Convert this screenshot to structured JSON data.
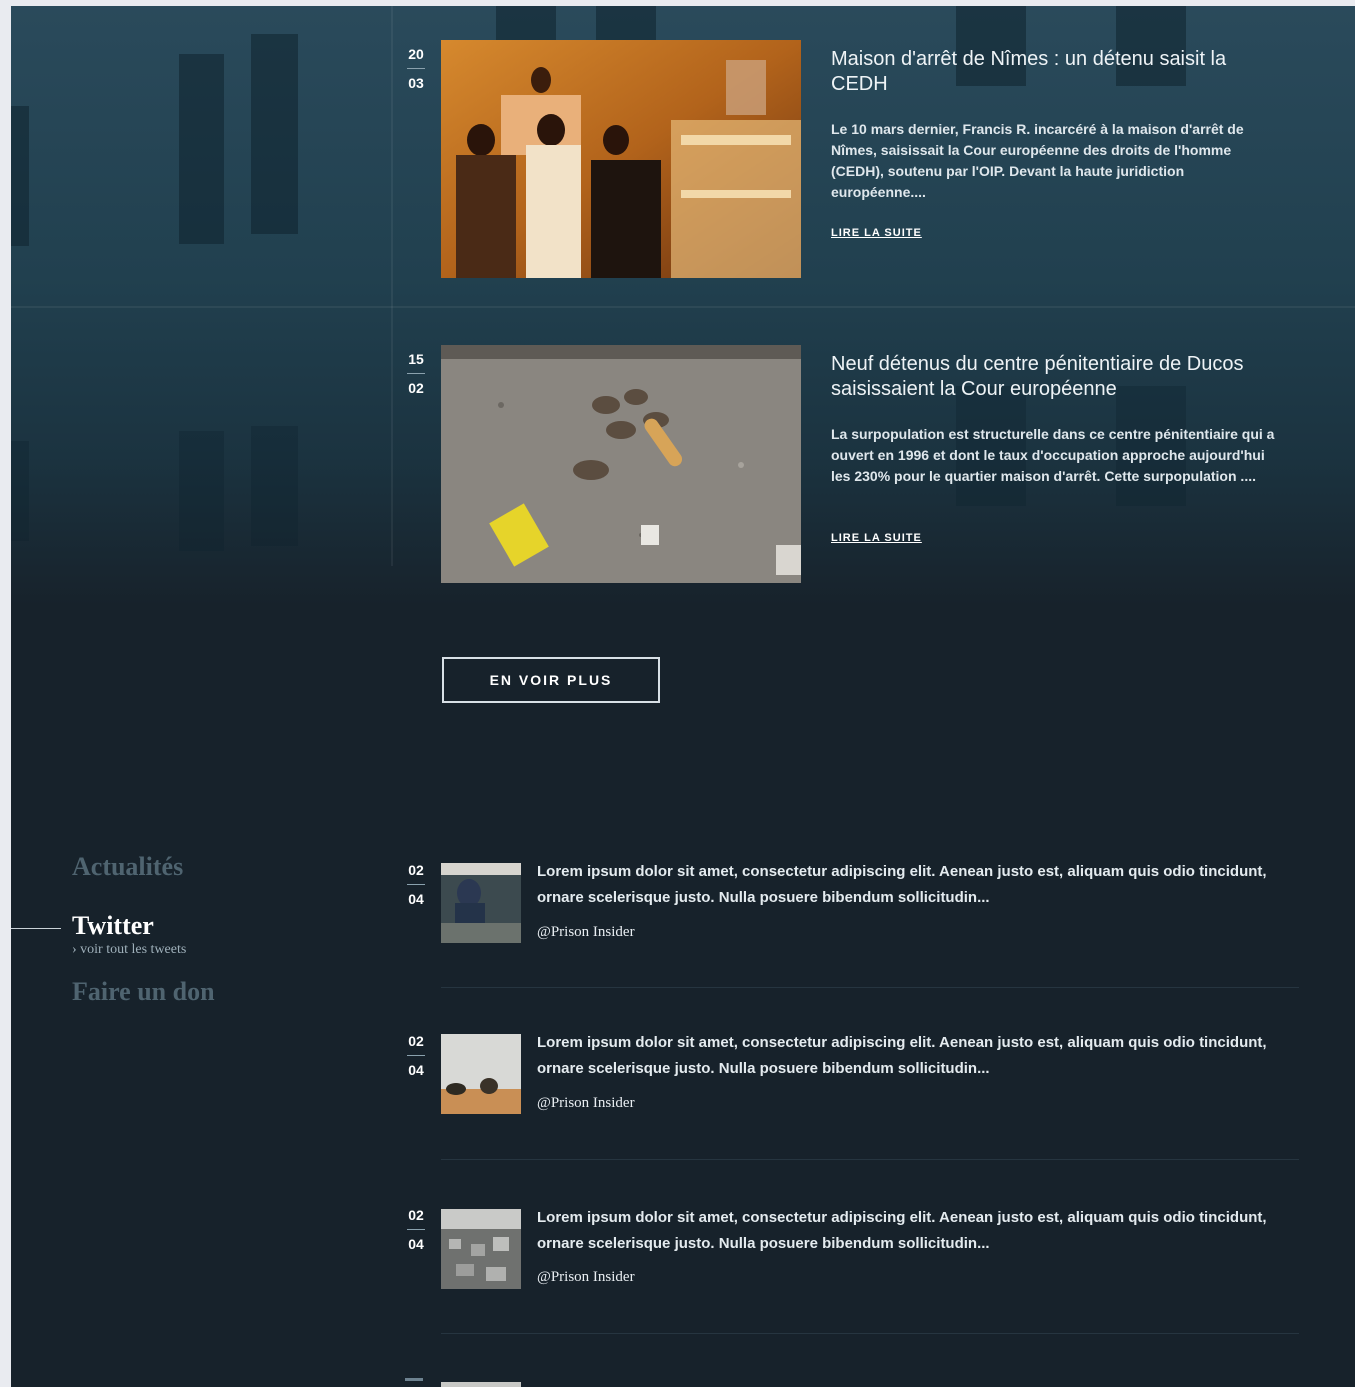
{
  "articles": [
    {
      "day": "20",
      "month": "03",
      "title": "Maison d'arrêt de Nîmes : un détenu saisit la CEDH",
      "excerpt": "Le 10 mars dernier, Francis R. incarcéré à la maison d'arrêt de Nîmes, saisissait la Cour européenne des droits de l'homme (CEDH), soutenu par l'OIP. Devant la haute juridiction européenne....",
      "link": "LIRE LA SUITE"
    },
    {
      "day": "15",
      "month": "02",
      "title": "Neuf détenus du centre pénitentiaire de Ducos saisissaient la Cour européenne",
      "excerpt": "La surpopulation est structurelle dans ce centre pénitentiaire qui a ouvert en 1996 et dont le taux d'occupation approche aujourd'hui les 230% pour le quartier maison d'arrêt. Cette surpopulation ....",
      "link": "LIRE LA SUITE"
    }
  ],
  "more_button": "EN VOIR PLUS",
  "sidenav": {
    "actualites": "Actualités",
    "twitter": "Twitter",
    "twitter_sub": "voir tout les tweets",
    "don": "Faire un don"
  },
  "tweets": [
    {
      "day": "02",
      "month": "04",
      "text": "Lorem ipsum dolor sit amet, consectetur adipiscing elit. Aenean justo est, aliquam quis odio tincidunt, ornare scelerisque justo. Nulla posuere bibendum sollicitudin...",
      "handle": "@Prison Insider"
    },
    {
      "day": "02",
      "month": "04",
      "text": "Lorem ipsum dolor sit amet, consectetur adipiscing elit. Aenean justo est, aliquam quis odio tincidunt, ornare scelerisque justo. Nulla posuere bibendum sollicitudin...",
      "handle": "@Prison Insider"
    },
    {
      "day": "02",
      "month": "04",
      "text": "Lorem ipsum dolor sit amet, consectetur adipiscing elit. Aenean justo est, aliquam quis odio tincidunt, ornare scelerisque justo. Nulla posuere bibendum sollicitudin...",
      "handle": "@Prison Insider"
    }
  ]
}
